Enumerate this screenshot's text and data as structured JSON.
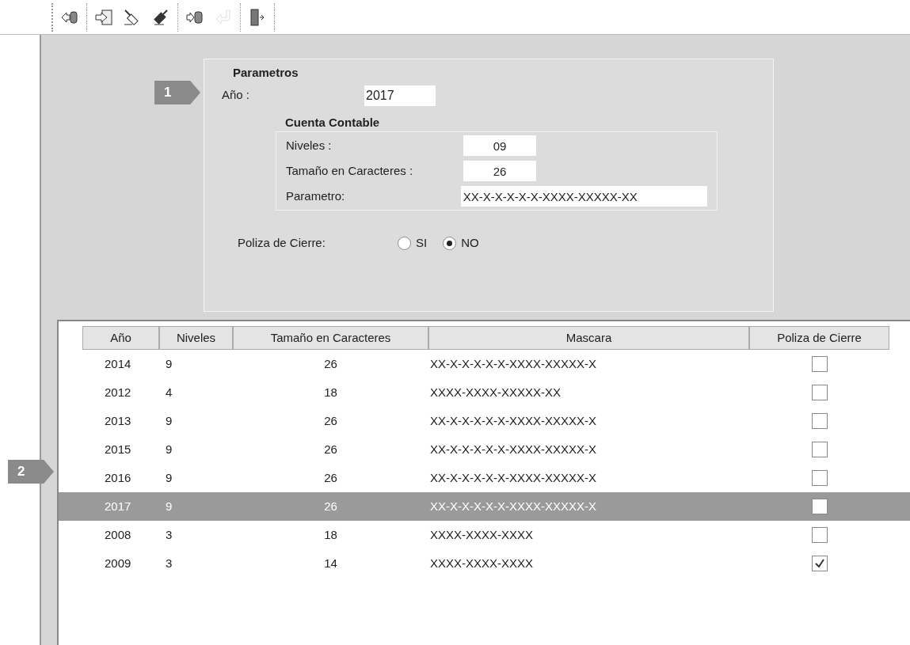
{
  "toolbar_groups": [
    {
      "buttons": [
        {
          "kind": "arrow-out-cylinder",
          "disabled": false
        }
      ]
    },
    {
      "buttons": [
        {
          "kind": "arrow-into-document",
          "disabled": false
        },
        {
          "kind": "plug",
          "disabled": false
        },
        {
          "kind": "dark-plug",
          "disabled": false
        }
      ]
    },
    {
      "buttons": [
        {
          "kind": "arrow-into-cylinder",
          "disabled": false
        },
        {
          "kind": "curved-arrow",
          "disabled": true
        }
      ]
    },
    {
      "buttons": [
        {
          "kind": "door",
          "disabled": false
        }
      ]
    }
  ],
  "callouts": [
    {
      "label": "1"
    },
    {
      "label": "2"
    }
  ],
  "parametros": {
    "title": "Parametros",
    "year": {
      "label": "Año :",
      "value": "2017"
    },
    "cuenta_contable": {
      "title": "Cuenta Contable",
      "fields": [
        {
          "label": "Niveles :",
          "value": "09",
          "kind": "short"
        },
        {
          "label": "Tamaño en Caracteres :",
          "value": "26",
          "kind": "short"
        },
        {
          "label": "Parametro:",
          "value": "XX-X-X-X-X-X-XXXX-XXXXX-XX",
          "kind": "long"
        }
      ]
    },
    "poliza_de_cierre": {
      "label": "Poliza de Cierre:",
      "options": [
        {
          "label": "SI",
          "selected": false
        },
        {
          "label": "NO",
          "selected": true
        }
      ]
    }
  },
  "table": {
    "columns": [
      "Año",
      "Niveles",
      "Tamaño en Caracteres",
      "Mascara",
      "Poliza de Cierre"
    ],
    "rows": [
      {
        "cells": [
          "2014",
          "9",
          "26",
          "XX-X-X-X-X-X-XXXX-XXXXX-X"
        ],
        "poliza": false,
        "selected": false
      },
      {
        "cells": [
          "2012",
          "4",
          "18",
          "XXXX-XXXX-XXXXX-XX"
        ],
        "poliza": false,
        "selected": false
      },
      {
        "cells": [
          "2013",
          "9",
          "26",
          "XX-X-X-X-X-X-XXXX-XXXXX-X"
        ],
        "poliza": false,
        "selected": false
      },
      {
        "cells": [
          "2015",
          "9",
          "26",
          "XX-X-X-X-X-X-XXXX-XXXXX-X"
        ],
        "poliza": false,
        "selected": false
      },
      {
        "cells": [
          "2016",
          "9",
          "26",
          "XX-X-X-X-X-X-XXXX-XXXXX-X"
        ],
        "poliza": false,
        "selected": false
      },
      {
        "cells": [
          "2017",
          "9",
          "26",
          "XX-X-X-X-X-X-XXXX-XXXXX-X"
        ],
        "poliza": false,
        "selected": true
      },
      {
        "cells": [
          "2008",
          "3",
          "18",
          "XXXX-XXXX-XXXX"
        ],
        "poliza": false,
        "selected": false
      },
      {
        "cells": [
          "2009",
          "3",
          "14",
          "XXXX-XXXX-XXXX"
        ],
        "poliza": true,
        "selected": false
      }
    ]
  }
}
